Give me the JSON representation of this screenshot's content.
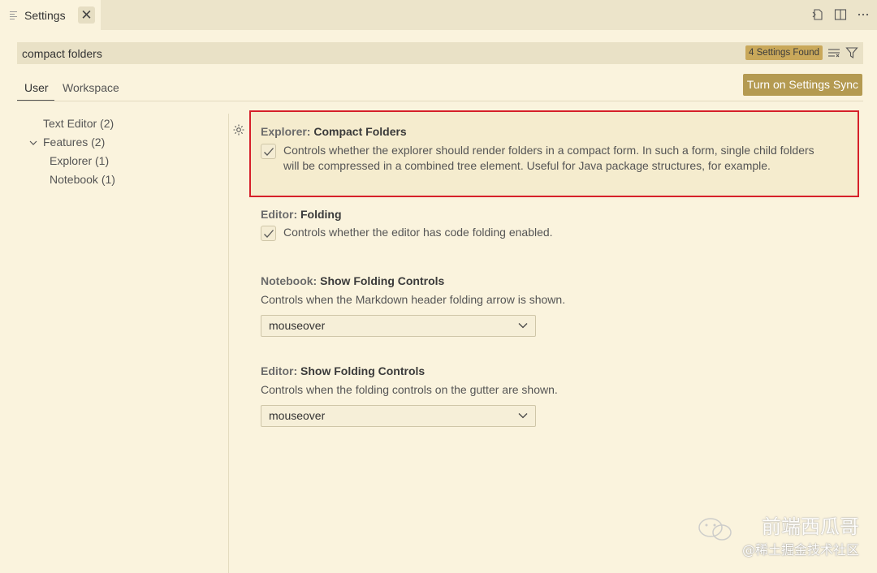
{
  "tab": {
    "title": "Settings",
    "close_glyph": "✕",
    "icon": "settings-file-icon"
  },
  "toolbar_icons": [
    "open-settings-json-icon",
    "split-editor-icon",
    "more-actions-icon"
  ],
  "search": {
    "value": "compact folders",
    "found_badge": "4 Settings Found",
    "icons": [
      "clear-filter-icon",
      "filter-icon"
    ]
  },
  "scopes": {
    "user": "User",
    "workspace": "Workspace"
  },
  "sync_button": "Turn on Settings Sync",
  "toc": {
    "text_editor": "Text Editor (2)",
    "features": "Features (2)",
    "explorer": "Explorer (1)",
    "notebook": "Notebook (1)"
  },
  "settings": [
    {
      "category": "Explorer: ",
      "name": "Compact Folders",
      "type": "checkbox",
      "checked": true,
      "description_line1": "Controls whether the explorer should render folders in a compact form. In such a form, single child folders",
      "description_line2": "will be compressed in a combined tree element. Useful for Java package structures, for example."
    },
    {
      "category": "Editor: ",
      "name": "Folding",
      "type": "checkbox",
      "checked": true,
      "description": "Controls whether the editor has code folding enabled."
    },
    {
      "category": "Notebook: ",
      "name": "Show Folding Controls",
      "type": "select",
      "description": "Controls when the Markdown header folding arrow is shown.",
      "value": "mouseover"
    },
    {
      "category": "Editor: ",
      "name": "Show Folding Controls",
      "type": "select",
      "description": "Controls when the folding controls on the gutter are shown.",
      "value": "mouseover"
    }
  ],
  "watermark": {
    "main": "前端西瓜哥",
    "sub": "@稀土掘金技术社区"
  },
  "colors": {
    "background": "#faf3dd",
    "badge": "#c9a85a",
    "sync_button": "#b49a51",
    "highlight_border": "#d6202a"
  }
}
